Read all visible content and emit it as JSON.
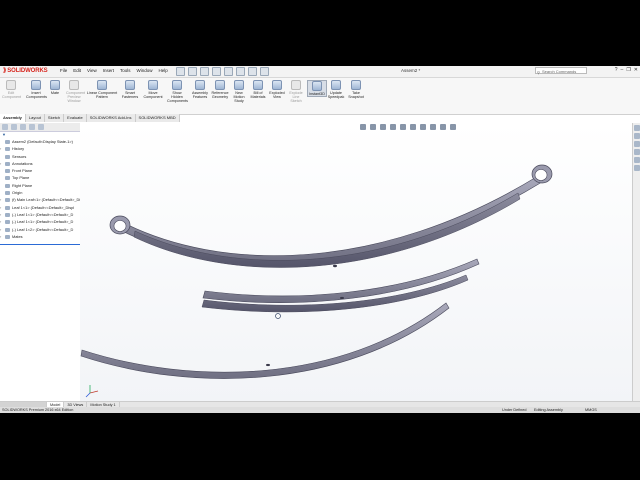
{
  "app": {
    "logo_text": "SOLIDWORKS",
    "document_title": "Assem2 *"
  },
  "menu": [
    "File",
    "Edit",
    "View",
    "Insert",
    "Tools",
    "Window",
    "Help"
  ],
  "search": {
    "placeholder": "Search Commands"
  },
  "window_controls": [
    "?",
    "–",
    "❐",
    "✕"
  ],
  "toolbar": {
    "tools": [
      {
        "label": "Edit Component",
        "disabled": true
      },
      {
        "label": "Insert Components",
        "disabled": false
      },
      {
        "label": "Mate",
        "disabled": false
      },
      {
        "label": "Component Preview Window",
        "disabled": true
      },
      {
        "label": "Linear Component Pattern",
        "disabled": false
      },
      {
        "label": "Smart Fasteners",
        "disabled": false
      },
      {
        "label": "Move Component",
        "disabled": false
      },
      {
        "label": "Show Hidden Components",
        "disabled": false
      },
      {
        "label": "Assembly Features",
        "disabled": false
      },
      {
        "label": "Reference Geometry",
        "disabled": false
      },
      {
        "label": "New Motion Study",
        "disabled": false
      },
      {
        "label": "Bill of Materials",
        "disabled": false
      },
      {
        "label": "Exploded View",
        "disabled": false
      },
      {
        "label": "Explode Line Sketch",
        "disabled": true
      },
      {
        "label": "Instant3D",
        "disabled": false,
        "active": true
      },
      {
        "label": "Update Speedpak",
        "disabled": false
      },
      {
        "label": "Take Snapshot",
        "disabled": false
      }
    ]
  },
  "tabs": [
    "Assembly",
    "Layout",
    "Sketch",
    "Evaluate",
    "SOLIDWORKS Add-Ins",
    "SOLIDWORKS MBD"
  ],
  "feature_tree": [
    {
      "label": "Assem2  (Default<Display State-1>)",
      "expand": ""
    },
    {
      "label": "History",
      "expand": "›"
    },
    {
      "label": "Sensors",
      "expand": ""
    },
    {
      "label": "Annotations",
      "expand": "›"
    },
    {
      "label": "Front Plane",
      "expand": ""
    },
    {
      "label": "Top Plane",
      "expand": ""
    },
    {
      "label": "Right Plane",
      "expand": ""
    },
    {
      "label": "Origin",
      "expand": ""
    },
    {
      "label": "(f) Main Leaf<1> (Default<<Default>_Display",
      "expand": "›"
    },
    {
      "label": "Leaf 1<1> (Default<<Default>_Displ",
      "expand": "›"
    },
    {
      "label": "(-) Leaf 1<1> (Default<<Default>_D",
      "expand": "›"
    },
    {
      "label": "(-) Leaf 1<1> (Default<<Default>_D",
      "expand": "›"
    },
    {
      "label": "(-) Leaf 1<2> (Default<<Default>_D",
      "expand": "›"
    },
    {
      "label": "Mates",
      "expand": "›"
    }
  ],
  "bottom_tabs": [
    "",
    "Model",
    "3D Views",
    "Motion Study 1"
  ],
  "status": {
    "edition": "SOLIDWORKS Premium 2016 x64 Edition",
    "under_defined": "Under Defined",
    "editing": "Editing Assembly",
    "units": "MMGS"
  },
  "colors": {
    "brand": "#d7261e",
    "accent": "#2b6bd6",
    "spring": "#8a8a9e"
  }
}
